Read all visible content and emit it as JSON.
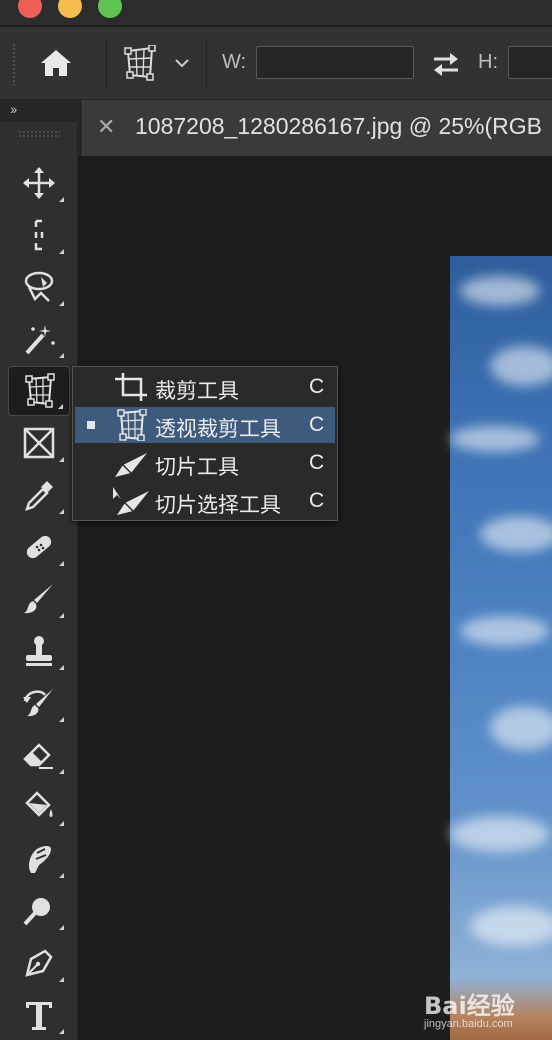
{
  "options_bar": {
    "width_label": "W:",
    "height_label": "H:",
    "width_value": "",
    "height_value": ""
  },
  "collapse_label": "››",
  "document": {
    "tab_title": "1087208_1280286167.jpg @ 25%(RGB"
  },
  "toolbar": {
    "tools": [
      "move-tool",
      "marquee-tool",
      "lasso-tool",
      "magic-wand-tool",
      "perspective-crop-tool",
      "frame-tool",
      "eyedropper-tool",
      "healing-brush-tool",
      "brush-tool",
      "clone-stamp-tool",
      "history-brush-tool",
      "eraser-tool",
      "paint-bucket-tool",
      "smudge-tool",
      "dodge-tool",
      "pen-tool",
      "type-tool"
    ],
    "active_tool": "perspective-crop-tool"
  },
  "flyout": {
    "items": [
      {
        "label": "裁剪工具",
        "shortcut": "C",
        "icon": "crop-icon",
        "selected": false
      },
      {
        "label": "透视裁剪工具",
        "shortcut": "C",
        "icon": "perspective-crop-icon",
        "selected": true
      },
      {
        "label": "切片工具",
        "shortcut": "C",
        "icon": "slice-icon",
        "selected": false
      },
      {
        "label": "切片选择工具",
        "shortcut": "C",
        "icon": "slice-select-icon",
        "selected": false
      }
    ]
  },
  "watermark": {
    "brand": "Bai经验",
    "url": "jingyan.baidu.com"
  },
  "colors": {
    "selection": "#3e5a7d",
    "panel": "#2f2f2f",
    "canvas": "#1d1d1d"
  }
}
